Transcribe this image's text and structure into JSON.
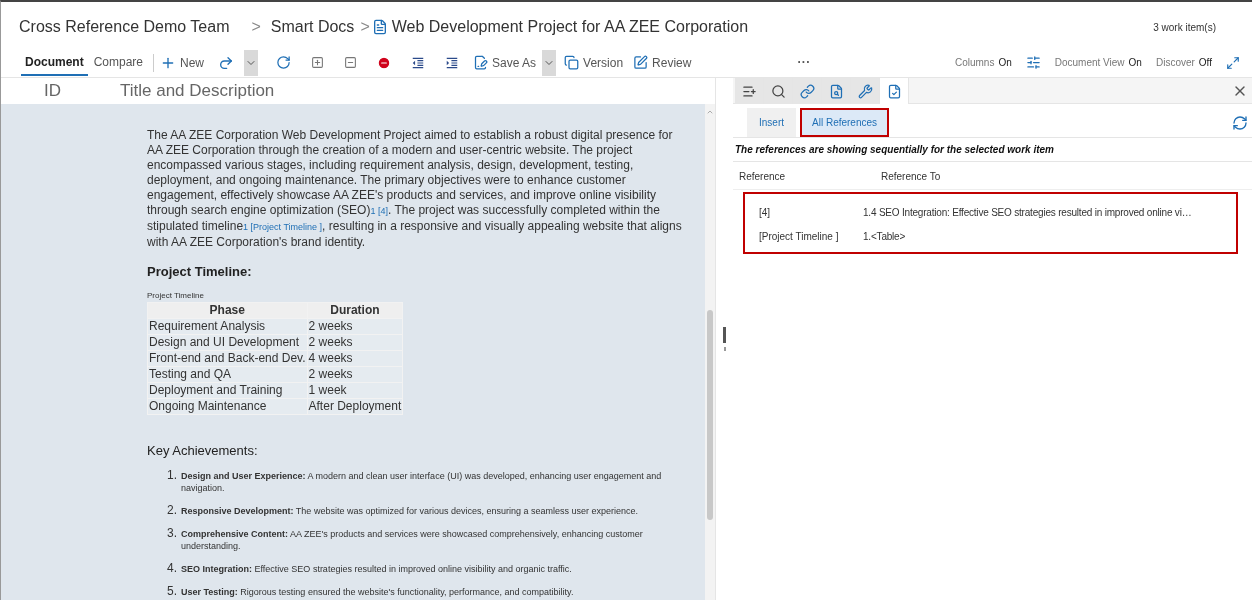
{
  "breadcrumb": {
    "team": "Cross Reference Demo Team",
    "separator": ">",
    "section": "Smart Docs",
    "document": "Web Development Project for AA ZEE Corporation"
  },
  "work_items": "3 work item(s)",
  "toolbar": {
    "tabs": [
      {
        "label": "Document",
        "selected": true
      },
      {
        "label": "Compare",
        "selected": false
      }
    ],
    "new": "New",
    "save_as": "Save As",
    "version": "Version",
    "review": "Review",
    "more": "...",
    "toggles": [
      {
        "label": "Columns",
        "value": "On"
      },
      {
        "label": "Document View",
        "value": "On"
      },
      {
        "label": "Discover",
        "value": "Off"
      }
    ]
  },
  "columns": [
    "ID",
    "Title and Description"
  ],
  "paragraph": [
    {
      "kind": "text",
      "text": "The AA ZEE Corporation Web Development Project aimed to establish a robust digital presence for AA ZEE Corporation through the creation of a modern and user-centric website. The project encompassed various stages, including requirement analysis, design, development, testing, deployment, and ongoing maintenance. The primary objectives were to enhance customer engagement, effectively showcase AA ZEE's products and services, and improve online visibility through search engine optimization (SEO)"
    },
    {
      "kind": "ref",
      "text": "1 [4]"
    },
    {
      "kind": "text",
      "text": ". The project was successfully completed within the stipulated timeline"
    },
    {
      "kind": "ref",
      "text": "1 [Project Timeline ]"
    },
    {
      "kind": "text",
      "text": ", resulting in a responsive and visually appealing website that aligns with AA ZEE Corporation's brand identity."
    }
  ],
  "timeline": {
    "heading": "Project Timeline:",
    "caption": "Project Timeline",
    "columns": [
      "Phase",
      "Duration"
    ],
    "rows": [
      [
        "Requirement Analysis",
        "2 weeks"
      ],
      [
        "Design and UI Development",
        "2 weeks"
      ],
      [
        "Front-end and Back-end Dev.",
        "4 weeks"
      ],
      [
        "Testing and QA",
        "2 weeks"
      ],
      [
        "Deployment and Training",
        "1 week"
      ],
      [
        "Ongoing Maintenance",
        "After Deployment"
      ]
    ]
  },
  "achievements": {
    "heading": "Key Achievements:",
    "items": [
      {
        "number": "1.",
        "text": "**Design and User Experience:** A modern and clean user interface (UI) was developed, enhancing user engagement and navigation."
      },
      {
        "number": "2.",
        "text": "**Responsive Development:** The website was optimized for various devices, ensuring a seamless user experience."
      },
      {
        "number": "3.",
        "text": "**Comprehensive Content:** AA ZEE's products and services were showcased comprehensively, enhancing customer understanding."
      },
      {
        "number": "4.",
        "text": "**SEO Integration:** Effective SEO strategies resulted in improved online visibility and organic traffic."
      },
      {
        "number": "5.",
        "text": "**User Testing:** Rigorous testing ensured the website's functionality, performance, and compatibility."
      }
    ]
  },
  "panel": {
    "icon_tabs": [
      {
        "selected": false
      },
      {
        "selected": false
      },
      {
        "selected": false
      },
      {
        "selected": false
      },
      {
        "selected": false
      },
      {
        "selected": true
      }
    ],
    "tabs": [
      {
        "label": "Insert",
        "selected": false
      },
      {
        "label": "All References",
        "selected": true
      }
    ],
    "note": "The references are showing sequentially for the selected work item",
    "columns": [
      "Reference",
      "Reference To"
    ],
    "rows": [
      [
        "[4]",
        "1.4 SEO Integration: Effective SEO strategies resulted in improved online vi…"
      ],
      [
        "[Project Timeline ]",
        "1.<Table>"
      ]
    ]
  }
}
